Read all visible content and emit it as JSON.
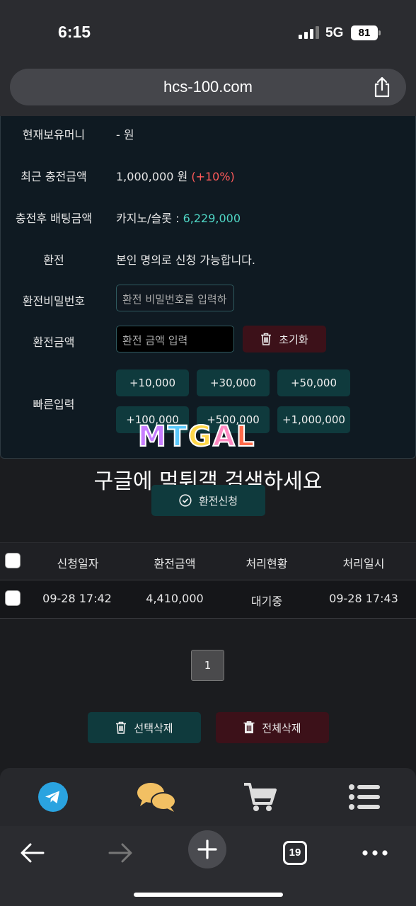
{
  "status": {
    "time": "6:15",
    "network": "5G",
    "battery": "81"
  },
  "browser": {
    "url": "hcs-100.com",
    "tab_count": "19"
  },
  "form": {
    "current_money_label": "현재보유머니",
    "current_money_value": "- 원",
    "recent_charge_label": "최근 충전금액",
    "recent_charge_value": "1,000,000 원",
    "recent_charge_bonus": "(+10%)",
    "bet_after_label": "충전후 배팅금액",
    "bet_after_prefix": "카지노/슬롯 :",
    "bet_after_amount": "6,229,000",
    "withdraw_label": "환전",
    "withdraw_note": "본인 명의로 신청 가능합니다.",
    "password_label": "환전비밀번호",
    "password_placeholder": "환전 비밀번호를 입력하",
    "amount_label": "환전금액",
    "amount_placeholder": "환전 금액 입력",
    "reset_label": "초기화",
    "quick_label": "빠른입력",
    "quick_amounts": [
      "+10,000",
      "+30,000",
      "+50,000",
      "+100,000",
      "+500,000",
      "+1,000,000"
    ],
    "apply_label": "환전신청"
  },
  "watermark": {
    "logo": "MTGAL",
    "text": "구글에 먹튀갤 검색하세요"
  },
  "table": {
    "headers": [
      "신청일자",
      "환전금액",
      "처리현황",
      "처리일시"
    ],
    "rows": [
      {
        "date": "09-28 17:42",
        "amount": "4,410,000",
        "status": "대기중",
        "processed": "09-28 17:43"
      }
    ]
  },
  "pagination": {
    "current": "1"
  },
  "actions": {
    "delete_selected": "선택삭제",
    "delete_all": "전체삭제"
  },
  "colors": {
    "red": "#ff5a5a",
    "teal": "#4fd6c5",
    "teal_button": "#0f3a3d",
    "maroon_button": "#3c1119",
    "telegram": "#2aa3e0",
    "chat": "#f2c063"
  }
}
